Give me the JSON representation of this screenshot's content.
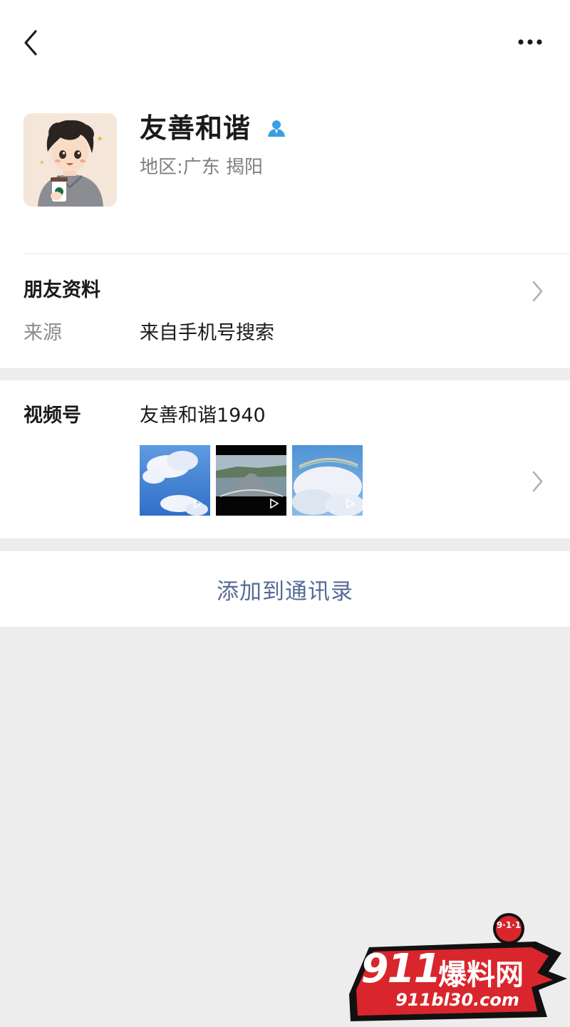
{
  "profile": {
    "name": "友善和谐",
    "region": "地区:广东 揭阳"
  },
  "friend_info": {
    "title": "朋友资料",
    "source_label": "来源",
    "source_value": "来自手机号搜索"
  },
  "channels": {
    "label": "视频号",
    "value": "友善和谐1940",
    "thumbnails": [
      "sky-clouds",
      "road-dashcam",
      "cloud-rainbow"
    ]
  },
  "actions": {
    "add_contact": "添加到通讯录"
  },
  "watermark": {
    "badge": "9·1·1",
    "main": "911",
    "sub": "爆料网",
    "url": "911bl30.com"
  },
  "colors": {
    "link_blue": "#576b95",
    "background": "#ededed",
    "badge_blue": "#3a9fe0"
  }
}
